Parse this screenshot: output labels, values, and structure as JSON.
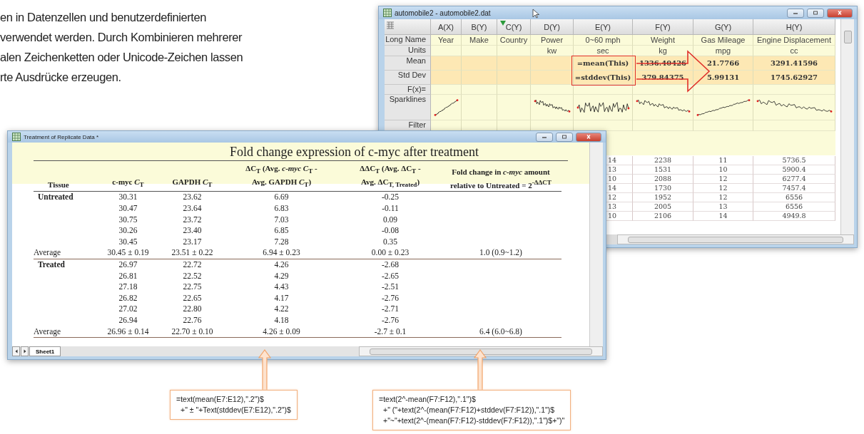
{
  "intro": {
    "lines": [
      "en in Datenzellen und benutzerdefinierten",
      "verwendet werden. Durch Kombinieren mehrerer",
      "alen Zeichenketten oder Unicode-Zeichen lassen",
      "rte Ausdrücke erzeugen."
    ]
  },
  "worksheet": {
    "title": "automobile2 - automobile2.dat",
    "row_labels": [
      "Long Name",
      "Units",
      "Mean",
      "Std Dev",
      "F(x)=",
      "Sparklines",
      "Filter"
    ],
    "columns": [
      {
        "label": "A(X)",
        "filter": false,
        "long_name": "Year",
        "sparkline": {
          "kind": "rising"
        }
      },
      {
        "label": "B(Y)",
        "filter": false,
        "long_name": "Make"
      },
      {
        "label": "C(Y)",
        "filter": true,
        "long_name": "Country"
      },
      {
        "label": "D(Y)",
        "filter": false,
        "long_name": "Power",
        "units": "kw",
        "sparkline": {
          "kind": "falling"
        }
      },
      {
        "label": "E(Y)",
        "filter": false,
        "long_name": "0~60 mph",
        "units": "sec",
        "mean": "=mean(This)",
        "std_dev": "=stddev(This)",
        "sparkline": {
          "kind": "noisy"
        }
      },
      {
        "label": "F(Y)",
        "filter": false,
        "long_name": "Weight",
        "units": "kg",
        "mean": "1336.40426",
        "std_dev": "379.84375",
        "sparkline": {
          "kind": "falling"
        }
      },
      {
        "label": "G(Y)",
        "filter": false,
        "long_name": "Gas Mileage",
        "units": "mpg",
        "mean": "21.7766",
        "std_dev": "5.99131",
        "sparkline": {
          "kind": "rising"
        }
      },
      {
        "label": "H(Y)",
        "filter": false,
        "long_name": "Engine Displacement",
        "units": "cc",
        "mean": "3291.41596",
        "std_dev": "1745.62927",
        "sparkline": {
          "kind": "falling"
        }
      }
    ],
    "data_rows": [
      [
        "14",
        "2238",
        "11",
        "5736.5"
      ],
      [
        "13",
        "1531",
        "10",
        "5900.4"
      ],
      [
        "10",
        "2088",
        "12",
        "6277.4"
      ],
      [
        "14",
        "1730",
        "12",
        "7457.4"
      ],
      [
        "12",
        "1952",
        "12",
        "6556"
      ],
      [
        "13",
        "2005",
        "13",
        "6556"
      ],
      [
        "10",
        "2106",
        "14",
        "4949.8"
      ]
    ]
  },
  "report": {
    "title": "Treatment of Replicate Data *",
    "heading": "Fold change expression of c-myc after treatment",
    "columns": [
      {
        "lines": [
          "Tissue"
        ]
      },
      {
        "lines": [
          "c-myc *C*$_{T}$"
        ]
      },
      {
        "lines": [
          "GAPDH *C*$_{T}$"
        ]
      },
      {
        "lines": [
          "ΔC$_{T}$ (Avg. *c-myc C*$_{T}$ -",
          "Avg. GAPDH *C*$_{T}$)"
        ]
      },
      {
        "lines": [
          "ΔΔC$_{T}$ (Avg. ΔC$_{T}$ -",
          "Avg. ΔC$_{T, Treated}$)"
        ]
      },
      {
        "lines": [
          "Fold change in *c-myc* amount",
          "relative to Untreated = 2$^{-ΔΔCT}$"
        ]
      }
    ],
    "groups": [
      {
        "name": "Untreated",
        "rows": [
          [
            "30.31",
            "23.62",
            "6.69",
            "-0.25"
          ],
          [
            "30.47",
            "23.64",
            "6.83",
            "-0.11"
          ],
          [
            "30.75",
            "23.72",
            "7.03",
            "0.09"
          ],
          [
            "30.26",
            "23.40",
            "6.85",
            "-0.08"
          ],
          [
            "30.45",
            "23.17",
            "7.28",
            "0.35"
          ]
        ],
        "average": {
          "label": "Average",
          "cells": [
            "30.45 ± 0.19",
            "23.51 ± 0.22",
            "6.94 ± 0.23",
            "0.00 ± 0.23",
            "1.0 (0.9~1.2)"
          ]
        }
      },
      {
        "name": "Treated",
        "rows": [
          [
            "26.97",
            "22.72",
            "4.26",
            "-2.68"
          ],
          [
            "26.81",
            "22.52",
            "4.29",
            "-2.65"
          ],
          [
            "27.18",
            "22.75",
            "4.43",
            "-2.51"
          ],
          [
            "26.82",
            "22.65",
            "4.17",
            "-2.76"
          ],
          [
            "27.02",
            "22.80",
            "4.22",
            "-2.71"
          ],
          [
            "26.94",
            "22.76",
            "4.18",
            "-2.76"
          ]
        ],
        "average": {
          "label": "Average",
          "cells": [
            "26.96 ± 0.14",
            "22.70 ± 0.10",
            "4.26 ± 0.09",
            "-2.7 ± 0.1",
            "6.4 (6.0~6.8)"
          ]
        }
      }
    ],
    "sheet_tab": "Sheet1"
  },
  "callouts": [
    {
      "lines": [
        "=text(mean(E7:E12),\".2\")$",
        "+\" ± \"+Text(stddev(E7:E12),\".2\")$"
      ]
    },
    {
      "lines": [
        "=text(2^-mean(F7:F12),\".1\")$",
        "+\" (\"+text(2^-(mean(F7:F12)+stddev(F7:F12)),\".1\")$",
        "+\"~\"+text(2^-(mean(F7:F12)-stddev(F7:F12)),\".1\")$+\")\""
      ]
    }
  ]
}
